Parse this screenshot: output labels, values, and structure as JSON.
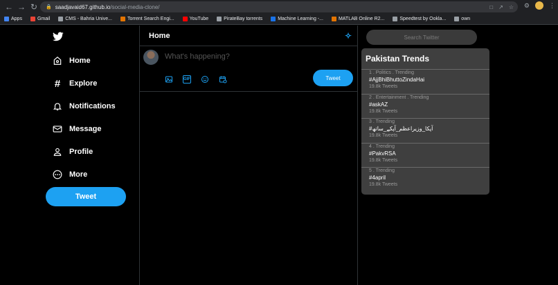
{
  "browser": {
    "url_host": "saadjavaid67.github.io",
    "url_path": "/social-media-clone/",
    "bookmarks": [
      {
        "label": "Apps",
        "color": "#4285f4"
      },
      {
        "label": "Gmail",
        "color": "#ea4335"
      },
      {
        "label": "CMS - Bahria Unive...",
        "color": "#9aa0a6"
      },
      {
        "label": "Torrent Search Engi...",
        "color": "#e37400"
      },
      {
        "label": "YouTube",
        "color": "#ff0000"
      },
      {
        "label": "PirateBay torrents",
        "color": "#9aa0a6"
      },
      {
        "label": "Machine Learning -...",
        "color": "#1a73e8"
      },
      {
        "label": "MATLAB Online R2...",
        "color": "#e37400"
      },
      {
        "label": "Speedtest by Ookla...",
        "color": "#9aa0a6"
      },
      {
        "label": "own",
        "color": "#9aa0a6"
      }
    ]
  },
  "sidebar": {
    "items": [
      {
        "label": "Home",
        "icon": "home-icon"
      },
      {
        "label": "Explore",
        "icon": "hashtag-icon"
      },
      {
        "label": "Notifications",
        "icon": "bell-icon"
      },
      {
        "label": "Message",
        "icon": "envelope-icon"
      },
      {
        "label": "Profile",
        "icon": "user-icon"
      },
      {
        "label": "More",
        "icon": "more-icon"
      }
    ],
    "tweet_label": "Tweet"
  },
  "main": {
    "title": "Home",
    "composer_placeholder": "What's happening?",
    "tweet_label": "Tweet"
  },
  "right": {
    "search_placeholder": "Search Twitter",
    "trends_title": "Pakistan Trends",
    "trends": [
      {
        "meta": "1 . Politics . Trending",
        "name": "#AjjBhiBhuttoZindaHai",
        "count": "19.8k Tweets"
      },
      {
        "meta": "2 . Entertainment . Trending",
        "name": "#askAZ",
        "count": "19.8k Tweets"
      },
      {
        "meta": "3 . Trending",
        "name": "#آپکا_وزیراعظم_آپکے_ساتھ",
        "count": "19.8k Tweets"
      },
      {
        "meta": "4 . Trending",
        "name": "#PakvRSA",
        "count": "19.8k Tweets"
      },
      {
        "meta": "5 . Trending",
        "name": "#4april",
        "count": "19.8k Tweets"
      }
    ]
  },
  "colors": {
    "accent": "#1da1f2",
    "background": "#000000",
    "panel": "#3f3f3f"
  }
}
